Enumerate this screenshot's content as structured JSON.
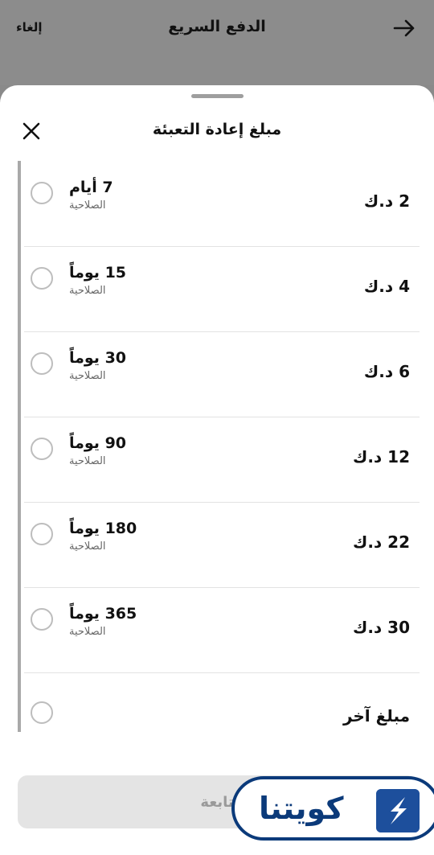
{
  "topbar": {
    "title": "الدفع السريع",
    "cancel_label": "إلغاء"
  },
  "sheet": {
    "title": "مبلغ إعادة التعبئة",
    "options": [
      {
        "validity": "7 أيام",
        "validity_label": "الصلاحية",
        "price": "2 د.ك"
      },
      {
        "validity": "15 يوماً",
        "validity_label": "الصلاحية",
        "price": "4 د.ك"
      },
      {
        "validity": "30 يوماً",
        "validity_label": "الصلاحية",
        "price": "6 د.ك"
      },
      {
        "validity": "90 يوماً",
        "validity_label": "الصلاحية",
        "price": "12 د.ك"
      },
      {
        "validity": "180 يوماً",
        "validity_label": "الصلاحية",
        "price": "22 د.ك"
      },
      {
        "validity": "365 يوماً",
        "validity_label": "الصلاحية",
        "price": "30 د.ك"
      }
    ],
    "other_amount_label": "مبلغ آخر",
    "continue_label": "تابعة"
  },
  "watermark": {
    "text": "كويتنا"
  },
  "colors": {
    "overlay": "#8a8a8a",
    "watermark_blue": "#0b3a7a",
    "button_disabled": "#e4e4e4"
  },
  "icons": {
    "back": "arrow-right-icon",
    "close": "close-icon",
    "logo": "lightning-logo-icon"
  }
}
